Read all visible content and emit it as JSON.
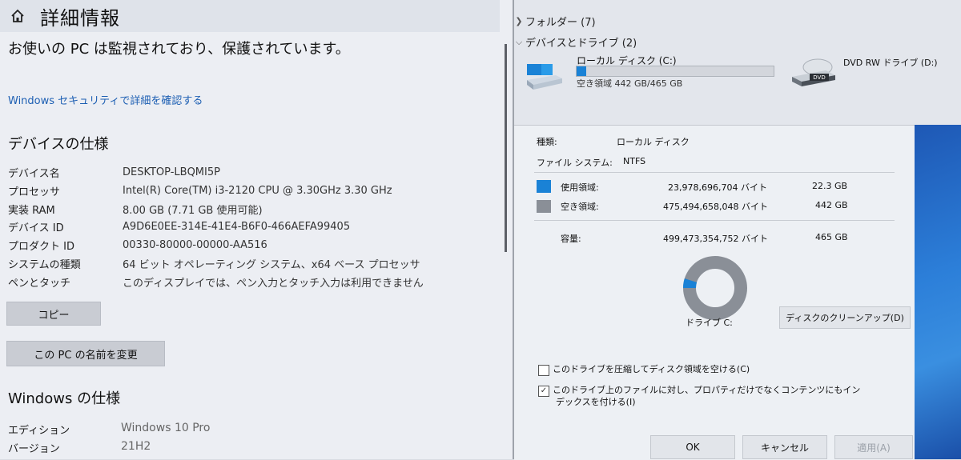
{
  "settings": {
    "title": "詳細情報",
    "protection_text": "お使いの PC は監視されており、保護されています。",
    "security_link": "Windows セキュリティで詳細を確認する",
    "device_spec_heading": "デバイスの仕様",
    "device_specs": [
      {
        "key": "デバイス名",
        "value": "DESKTOP-LBQMI5P"
      },
      {
        "key": "プロセッサ",
        "value": "Intel(R) Core(TM) i3-2120 CPU @ 3.30GHz   3.30 GHz"
      },
      {
        "key": "実装 RAM",
        "value": "8.00 GB (7.71 GB 使用可能)"
      },
      {
        "key": "デバイス ID",
        "value": "A9D6E0EE-314E-41E4-B6F0-466AEFA99405"
      },
      {
        "key": "プロダクト ID",
        "value": "00330-80000-00000-AA516"
      },
      {
        "key": "システムの種類",
        "value": "64 ビット オペレーティング システム、x64 ベース プロセッサ"
      },
      {
        "key": "ペンとタッチ",
        "value": "このディスプレイでは、ペン入力とタッチ入力は利用できません"
      }
    ],
    "copy_button": "コピー",
    "rename_button": "この PC の名前を変更",
    "windows_spec_heading": "Windows の仕様",
    "windows_specs": [
      {
        "key": "エディション",
        "value": "Windows 10 Pro"
      },
      {
        "key": "バージョン",
        "value": "21H2"
      }
    ]
  },
  "explorer": {
    "folders_group": "フォルダー (7)",
    "devices_group": "デバイスとドライブ (2)",
    "drive_c": {
      "name": "ローカル ディスク (C:)",
      "space": "空き領域 442 GB/465 GB",
      "used_fraction": 0.05
    },
    "dvd": {
      "name": "DVD RW ドライブ (D:)",
      "icon_label": "DVD"
    }
  },
  "properties": {
    "type_label": "種類:",
    "type_value": "ローカル ディスク",
    "fs_label": "ファイル システム:",
    "fs_value": "NTFS",
    "used_label": "使用領域:",
    "used_bytes": "23,978,696,704 バイト",
    "used_gb": "22.3 GB",
    "free_label": "空き領域:",
    "free_bytes": "475,494,658,048 バイト",
    "free_gb": "442 GB",
    "capacity_label": "容量:",
    "capacity_bytes": "499,473,354,752 バイト",
    "capacity_gb": "465 GB",
    "drive_label": "ドライブ C:",
    "cleanup_button": "ディスクのクリーンアップ(D)",
    "compress_label": "このドライブを圧縮してディスク領域を空ける(C)",
    "compress_checked": false,
    "index_label_1": "このドライブ上のファイルに対し、プロパティだけでなくコンテンツにもイン",
    "index_label_2": "デックスを付ける(I)",
    "index_checked": true,
    "ok_button": "OK",
    "cancel_button": "キャンセル",
    "apply_button": "適用(A)",
    "used_color": "#1a82d6",
    "free_color": "#8a8f97",
    "used_fraction": 0.048
  }
}
